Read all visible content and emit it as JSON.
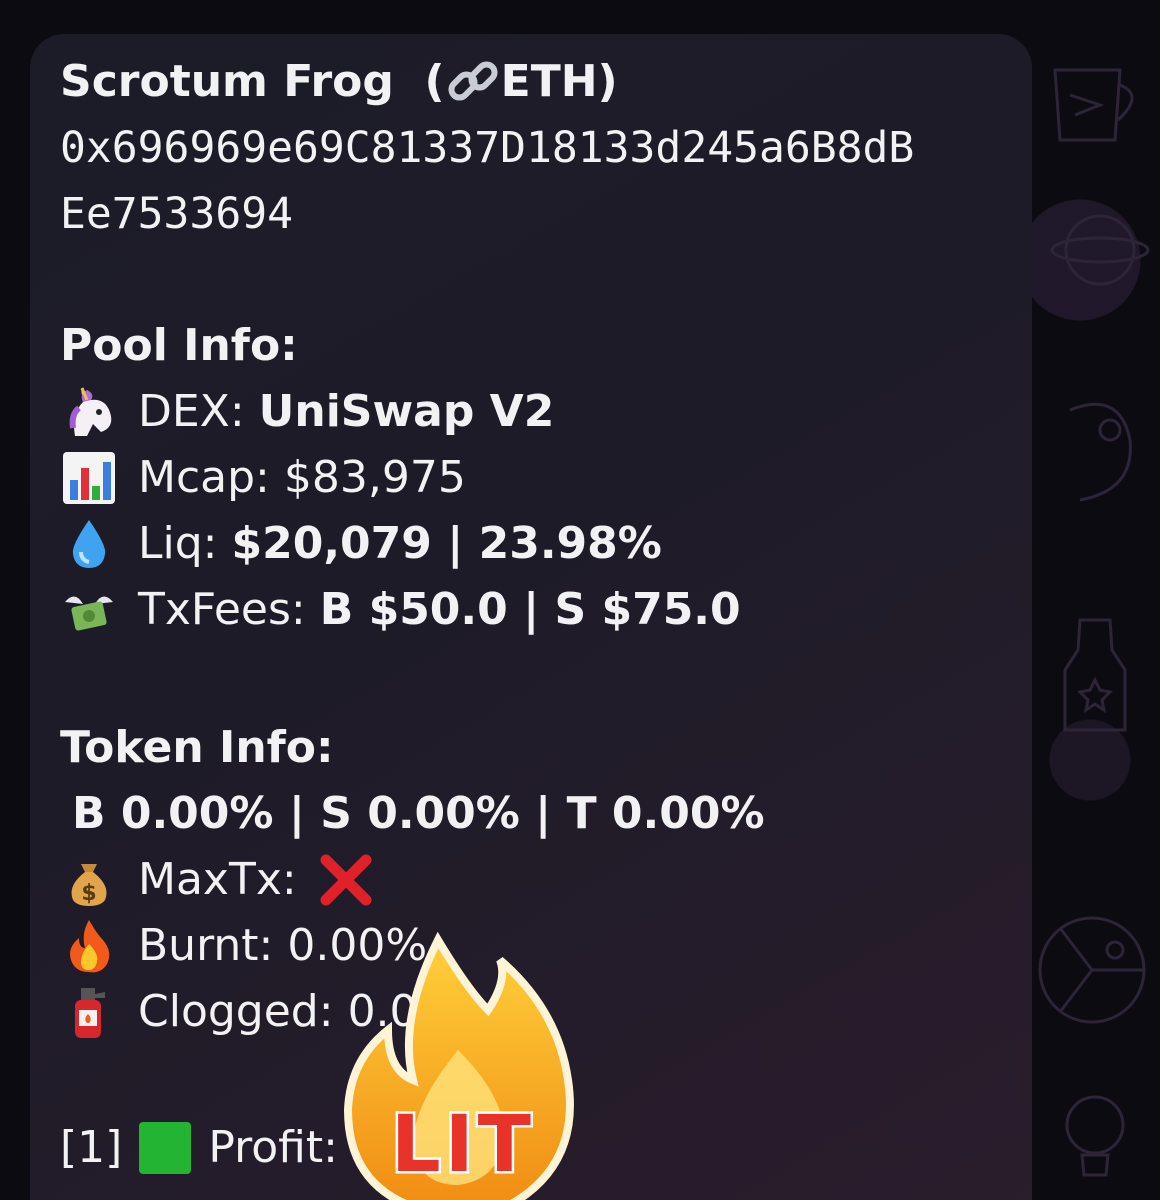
{
  "token": {
    "name": "Scrotum Frog",
    "chain": "ETH",
    "address_line1": "0x696969e69C81337D18133d245a6B8dB",
    "address_line2": "Ee7533694"
  },
  "pool": {
    "heading": "Pool Info:",
    "dex_label": "DEX:",
    "dex_value": "UniSwap V2",
    "mcap_label": "Mcap:",
    "mcap_value": "$83,975",
    "liq_label": "Liq:",
    "liq_value": "$20,079 | 23.98%",
    "fees_label": "TxFees:",
    "fees_value": "B  $50.0 | S  $75.0"
  },
  "token_info": {
    "heading": "Token Info:",
    "taxes": "B   0.00% | S  0.00% | T  0.00%",
    "maxtx_label": "MaxTx:",
    "burnt_label": "Burnt:",
    "burnt_value": "0.00%",
    "clogged_label": "Clogged:",
    "clogged_value": "0.00%"
  },
  "profit": {
    "index": "[1]",
    "label": "Profit:"
  },
  "sticker": {
    "text": "LIT"
  },
  "icons": {
    "chain": "link-icon",
    "dex": "unicorn-icon",
    "mcap": "bar-chart-icon",
    "liq": "droplet-icon",
    "fees": "money-wings-icon",
    "maxtx": "money-bag-icon",
    "maxtx_status": "cross-mark-icon",
    "burnt": "fire-icon",
    "clogged": "fire-extinguisher-icon",
    "profit": "green-square-icon"
  },
  "colors": {
    "bubble_bg": "#1e1b28",
    "text": "#f2f2f4",
    "cross": "#e0202a",
    "green_square": "#22b432",
    "sticker_flame": "#f6a21a",
    "sticker_text": "#e8332b"
  }
}
